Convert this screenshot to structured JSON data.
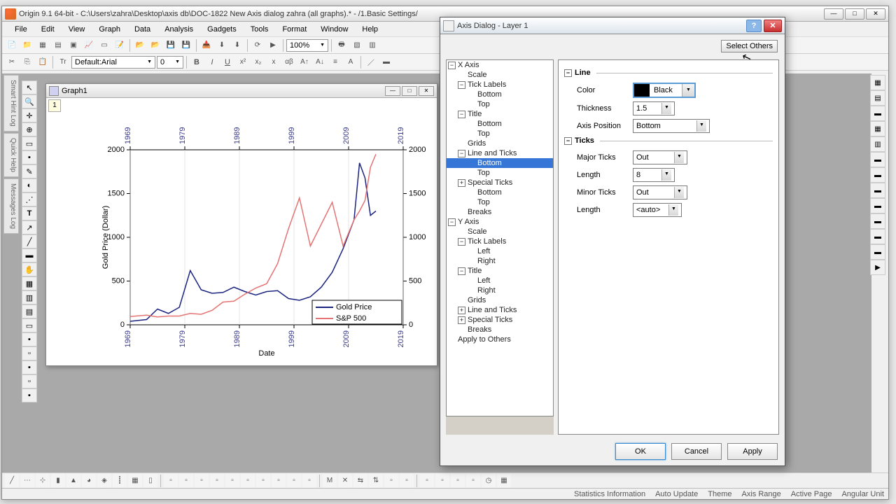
{
  "app": {
    "title": "Origin 9.1 64-bit - C:\\Users\\zahra\\Desktop\\axis db\\DOC-1822 New Axis dialog zahra (all graphs).* - /1.Basic Settings/"
  },
  "menu": {
    "items": [
      "File",
      "Edit",
      "View",
      "Graph",
      "Data",
      "Analysis",
      "Gadgets",
      "Tools",
      "Format",
      "Window",
      "Help"
    ]
  },
  "format_toolbar": {
    "font_label_prefix": "Default: ",
    "font": "Arial",
    "size": "0"
  },
  "graph": {
    "zoom": "100%",
    "window_title": "Graph1",
    "tab": "1",
    "y_axis_label": "Gold Price (Dollar)",
    "x_axis_label": "Date",
    "legend": {
      "series1": "Gold Price",
      "series2": "S&P 500"
    },
    "y_ticks": [
      "0",
      "500",
      "1000",
      "1500",
      "2000"
    ],
    "x_ticks_top": [
      "1969",
      "1979",
      "1989",
      "1999",
      "2009",
      "2019"
    ],
    "x_ticks_bottom": [
      "1969",
      "1979",
      "1989",
      "1999",
      "2009",
      "2019"
    ]
  },
  "chart_data": {
    "type": "line",
    "title": "",
    "xlabel": "Date",
    "ylabel": "Gold Price (Dollar)",
    "xlim": [
      1969,
      2019
    ],
    "ylim": [
      0,
      2000
    ],
    "x": [
      1969,
      1972,
      1974,
      1976,
      1978,
      1980,
      1982,
      1984,
      1986,
      1988,
      1990,
      1992,
      1994,
      1996,
      1998,
      2000,
      2002,
      2004,
      2006,
      2008,
      2010,
      2011,
      2012,
      2013,
      2014
    ],
    "series": [
      {
        "name": "Gold Price",
        "color": "#1a237e",
        "values": [
          40,
          60,
          180,
          130,
          200,
          620,
          400,
          360,
          370,
          430,
          380,
          340,
          380,
          390,
          300,
          280,
          320,
          430,
          600,
          870,
          1200,
          1850,
          1680,
          1250,
          1300
        ]
      },
      {
        "name": "S&P 500",
        "color": "#e57373",
        "values": [
          95,
          110,
          90,
          100,
          100,
          130,
          120,
          165,
          260,
          270,
          350,
          420,
          470,
          700,
          1100,
          1450,
          900,
          1150,
          1400,
          900,
          1200,
          1300,
          1420,
          1800,
          1950
        ]
      }
    ]
  },
  "dialog": {
    "title": "Axis Dialog - Layer 1",
    "select_others": "Select Others",
    "ok": "OK",
    "cancel": "Cancel",
    "apply": "Apply",
    "tree": [
      {
        "d": 0,
        "tog": "-",
        "label": "X Axis"
      },
      {
        "d": 1,
        "tog": "",
        "label": "Scale"
      },
      {
        "d": 1,
        "tog": "-",
        "label": "Tick Labels"
      },
      {
        "d": 2,
        "tog": "",
        "label": "Bottom"
      },
      {
        "d": 2,
        "tog": "",
        "label": "Top"
      },
      {
        "d": 1,
        "tog": "-",
        "label": "Title"
      },
      {
        "d": 2,
        "tog": "",
        "label": "Bottom"
      },
      {
        "d": 2,
        "tog": "",
        "label": "Top"
      },
      {
        "d": 1,
        "tog": "",
        "label": "Grids"
      },
      {
        "d": 1,
        "tog": "-",
        "label": "Line and Ticks"
      },
      {
        "d": 2,
        "tog": "",
        "label": "Bottom",
        "selected": true
      },
      {
        "d": 2,
        "tog": "",
        "label": "Top"
      },
      {
        "d": 1,
        "tog": "+",
        "label": "Special Ticks"
      },
      {
        "d": 2,
        "tog": "",
        "label": "Bottom"
      },
      {
        "d": 2,
        "tog": "",
        "label": "Top"
      },
      {
        "d": 1,
        "tog": "",
        "label": "Breaks"
      },
      {
        "d": 0,
        "tog": "-",
        "label": "Y Axis"
      },
      {
        "d": 1,
        "tog": "",
        "label": "Scale"
      },
      {
        "d": 1,
        "tog": "-",
        "label": "Tick Labels"
      },
      {
        "d": 2,
        "tog": "",
        "label": "Left"
      },
      {
        "d": 2,
        "tog": "",
        "label": "Right"
      },
      {
        "d": 1,
        "tog": "-",
        "label": "Title"
      },
      {
        "d": 2,
        "tog": "",
        "label": "Left"
      },
      {
        "d": 2,
        "tog": "",
        "label": "Right"
      },
      {
        "d": 1,
        "tog": "",
        "label": "Grids"
      },
      {
        "d": 1,
        "tog": "+",
        "label": "Line and Ticks"
      },
      {
        "d": 1,
        "tog": "+",
        "label": "Special Ticks"
      },
      {
        "d": 1,
        "tog": "",
        "label": "Breaks"
      },
      {
        "d": 0,
        "tog": "",
        "label": "Apply to Others"
      }
    ],
    "line": {
      "header": "Line",
      "color_label": "Color",
      "color_value": "Black",
      "color_hex": "#000000",
      "thickness_label": "Thickness",
      "thickness_value": "1.5",
      "axis_position_label": "Axis Position",
      "axis_position_value": "Bottom"
    },
    "ticks": {
      "header": "Ticks",
      "major_label": "Major Ticks",
      "major_value": "Out",
      "length1_label": "Length",
      "length1_value": "8",
      "minor_label": "Minor Ticks",
      "minor_value": "Out",
      "length2_label": "Length",
      "length2_value": "<auto>"
    }
  },
  "status": {
    "items": [
      "Statistics Information",
      "Auto Update",
      "Theme",
      "Axis Range",
      "Active Page",
      "Angular Unit"
    ]
  },
  "sidebar_tabs": [
    "Smart Hint Log",
    "Quick Help",
    "Messages Log"
  ]
}
